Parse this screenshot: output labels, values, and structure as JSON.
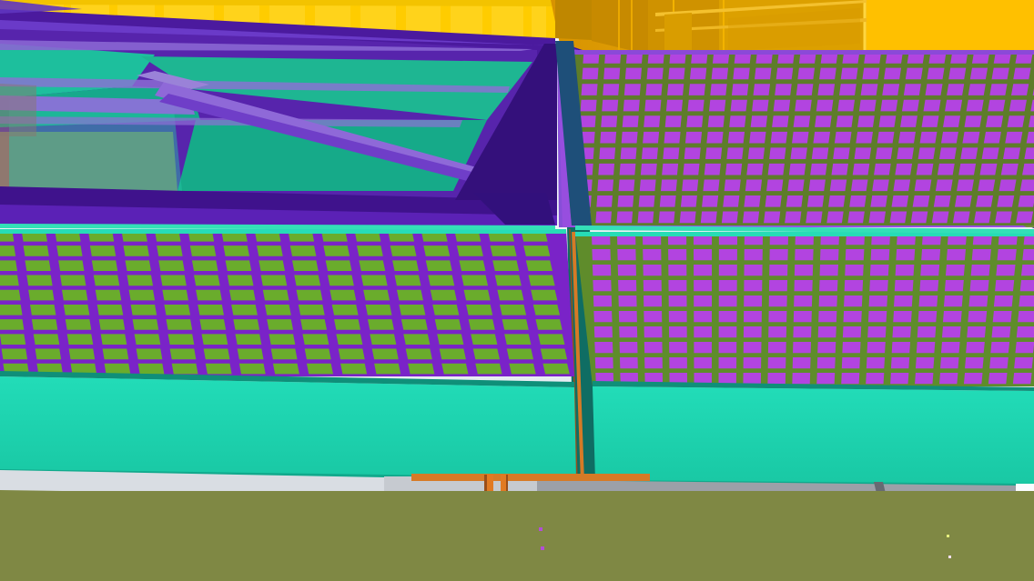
{
  "scene": {
    "kind": "3D BIM model render",
    "colors": {
      "ground": "#7f8844",
      "sky": "#eef3f8",
      "wall_yellow": "#ffc400",
      "wall_yellow_shadow": "#d89a00",
      "roof_purple": "#4a1d93",
      "roof_purple_dark": "#34106f",
      "teal": "#20d9b5",
      "teal_dark": "#16b898",
      "green_panel": "#6aac2c",
      "magenta_panel": "#b244e0",
      "orange_beam": "#d67a26",
      "gray_panel": "#9da1a6"
    },
    "grid_left": {
      "rows": 10,
      "cols": 17
    },
    "grid_right": {
      "rows": 10,
      "cols": 18
    },
    "grid_far_right": {
      "rows": 11,
      "cols": 22
    }
  }
}
